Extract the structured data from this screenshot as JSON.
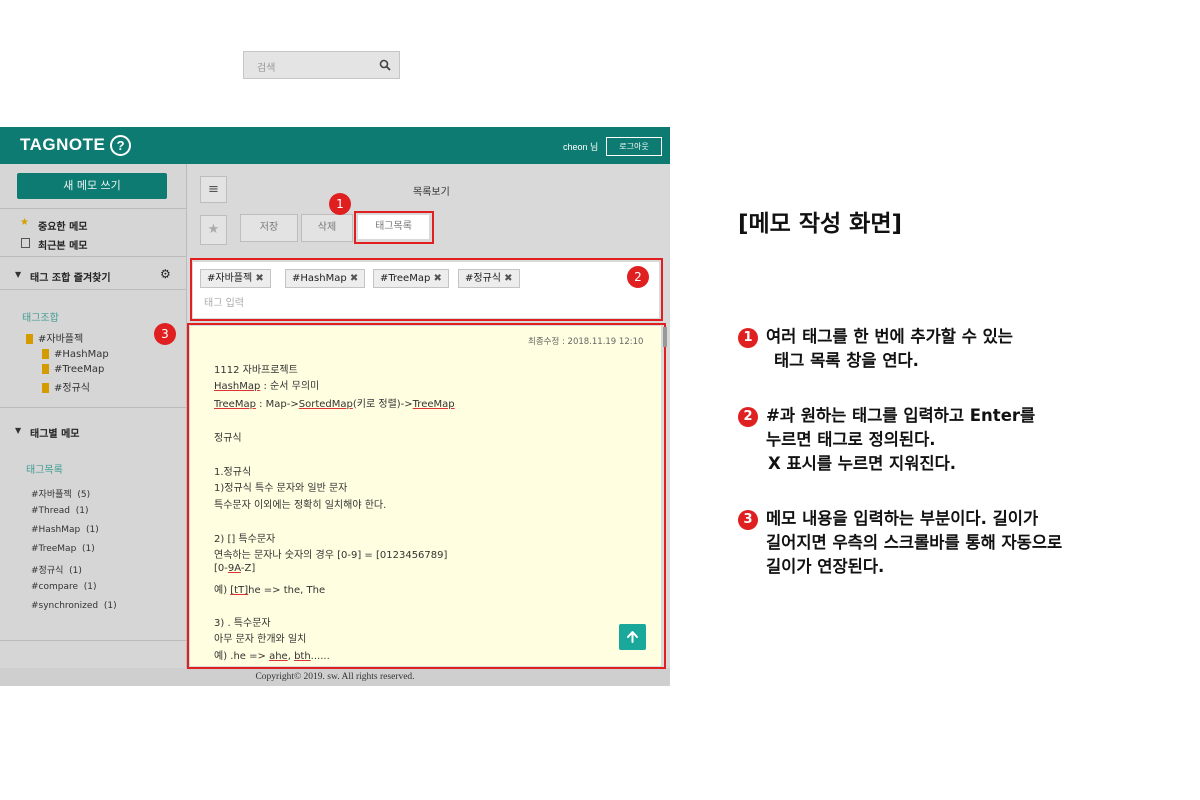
{
  "app": {
    "logo": "TAGNOTE",
    "help_icon_char": "?",
    "user_label": "cheon 님",
    "logout_label": "로그아웃",
    "footer": "Copyright© 2019. sw. All rights reserved."
  },
  "sidebar": {
    "new_memo_label": "새 메모 쓰기",
    "important_label": "중요한 메모",
    "recent_label": "최근본 메모",
    "favorites_title": "태그 조합 즐겨찾기",
    "tag_combo_label": "태그조합",
    "tag_tree": [
      "#자바플젝",
      "#HashMap",
      "#TreeMap",
      "#정규식"
    ],
    "tag_memo_title": "태그별 메모",
    "tag_list_label": "태그목록",
    "tag_counts": [
      {
        "tag": "#자바플젝",
        "count": "(5)"
      },
      {
        "tag": "#Thread",
        "count": "(1)"
      },
      {
        "tag": "#HashMap",
        "count": "(1)"
      },
      {
        "tag": "#TreeMap",
        "count": "(1)"
      },
      {
        "tag": "#정규식",
        "count": "(1)"
      },
      {
        "tag": "#compare",
        "count": "(1)"
      },
      {
        "tag": "#synchronized",
        "count": "(1)"
      }
    ]
  },
  "toolbar": {
    "search_placeholder": "검색",
    "list_view_label": "목록보기",
    "save_label": "저장",
    "delete_label": "삭제",
    "tag_list_label": "태그목록"
  },
  "tags": {
    "chips": [
      "#자바플젝",
      "#HashMap",
      "#TreeMap",
      "#정규식"
    ],
    "input_placeholder": "태그 입력"
  },
  "memo": {
    "last_modified": "최종수정 : 2018.11.19 12:10",
    "l1": "1112 자바프로젝트",
    "l2a": "HashMap",
    "l2b": " : 순서 무의미",
    "l3a": "TreeMap",
    "l3b": " : Map->",
    "l3c": "SortedMap",
    "l3d": "(키로 정렬)->",
    "l3e": "TreeMap",
    "l4": "정규식",
    "l5": "1.정규식",
    "l6": "1)정규식 특수 문자와 일반 문자",
    "l7": "특수문자 이외에는 정확히 일치해야 한다.",
    "l8": "2) [] 특수문자",
    "l9": "연속하는 문자나 숫자의 경우 [0-9] = [0123456789]",
    "l10a": "[0-",
    "l10b": "9A",
    "l10c": "-Z]",
    "l11a": "예) ",
    "l11b": "[tT]",
    "l11c": "he  => the, The",
    "l12": "3) . 특수문자",
    "l13": "아무 문자 한개와 일치",
    "l14a": "예) .he  => ",
    "l14b": "ahe",
    "l14c": ", ",
    "l14d": "bth",
    "l14e": "......",
    "scroll_top_icon": "arrow-up"
  },
  "annotations": {
    "badges": [
      "1",
      "2",
      "3"
    ],
    "heading": "[메모 작성 화면]",
    "items": [
      {
        "num": "1",
        "lines": [
          "여러 태그를 한 번에 추가할 수 있는",
          "태그 목록 창을 연다."
        ]
      },
      {
        "num": "2",
        "lines": [
          "#과 원하는 태그를 입력하고 Enter를",
          "누르면 태그로 정의된다.",
          "X 표시를 누르면 지워진다."
        ]
      },
      {
        "num": "3",
        "lines": [
          "메모 내용을 입력하는 부분이다. 길이가",
          "길어지면 우측의 스크롤바를 통해 자동으로",
          "길이가 연장된다."
        ]
      }
    ]
  },
  "colors": {
    "brand": "#0e7b73",
    "highlight": "#e02020",
    "memo_bg": "#fffee0",
    "bookmark": "#d49b00"
  }
}
